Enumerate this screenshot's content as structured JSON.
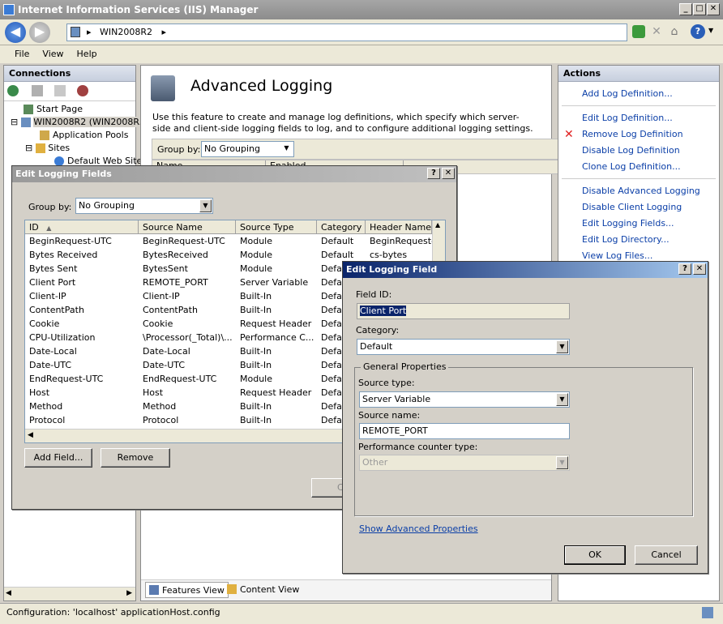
{
  "window": {
    "title": "Internet Information Services (IIS) Manager"
  },
  "address": {
    "path": "WIN2008R2"
  },
  "menu": [
    "File",
    "View",
    "Help"
  ],
  "connections": {
    "title": "Connections",
    "tree": [
      "Start Page",
      "WIN2008R2 (WIN2008R...",
      "Application Pools",
      "Sites",
      "Default Web Site"
    ]
  },
  "center": {
    "title": "Advanced Logging",
    "description": "Use this feature to create and manage log definitions, which specify which server-side and client-side logging fields to log, and to configure additional logging settings.",
    "group_by_label": "Group by:",
    "group_by_value": "No Grouping",
    "col_name": "Name",
    "col_enabled": "Enabled",
    "features_view": "Features View",
    "content_view": "Content View"
  },
  "actions": {
    "title": "Actions",
    "items": [
      "Add Log Definition...",
      "Edit Log Definition...",
      "Remove Log Definition",
      "Disable Log Definition",
      "Clone Log Definition...",
      "Disable Advanced Logging",
      "Disable Client Logging",
      "Edit Logging Fields...",
      "Edit Log Directory...",
      "View Log Files..."
    ]
  },
  "fields_dialog": {
    "title": "Edit Logging Fields",
    "group_by_label": "Group by:",
    "group_by_value": "No Grouping",
    "columns": [
      "ID",
      "Source Name",
      "Source Type",
      "Category",
      "Header Name"
    ],
    "rows": [
      [
        "BeginRequest-UTC",
        "BeginRequest-UTC",
        "Module",
        "Default",
        "BeginRequest-..."
      ],
      [
        "Bytes Received",
        "BytesReceived",
        "Module",
        "Default",
        "cs-bytes"
      ],
      [
        "Bytes Sent",
        "BytesSent",
        "Module",
        "Defa",
        ""
      ],
      [
        "Client Port",
        "REMOTE_PORT",
        "Server Variable",
        "Defa",
        ""
      ],
      [
        "Client-IP",
        "Client-IP",
        "Built-In",
        "Defa",
        ""
      ],
      [
        "ContentPath",
        "ContentPath",
        "Built-In",
        "Defa",
        ""
      ],
      [
        "Cookie",
        "Cookie",
        "Request Header",
        "Defa",
        ""
      ],
      [
        "CPU-Utilization",
        "\\Processor(_Total)\\...",
        "Performance C...",
        "Defa",
        ""
      ],
      [
        "Date-Local",
        "Date-Local",
        "Built-In",
        "Defa",
        ""
      ],
      [
        "Date-UTC",
        "Date-UTC",
        "Built-In",
        "Defa",
        ""
      ],
      [
        "EndRequest-UTC",
        "EndRequest-UTC",
        "Module",
        "Defa",
        ""
      ],
      [
        "Host",
        "Host",
        "Request Header",
        "Defa",
        ""
      ],
      [
        "Method",
        "Method",
        "Built-In",
        "Defa",
        ""
      ],
      [
        "Protocol",
        "Protocol",
        "Built-In",
        "Defa",
        ""
      ]
    ],
    "add_button": "Add Field...",
    "remove_button": "Remove",
    "hidden_button": "C"
  },
  "field_dialog": {
    "title": "Edit Logging Field",
    "field_id_label": "Field ID:",
    "field_id_value": "Client Port",
    "category_label": "Category:",
    "category_value": "Default",
    "general_group": "General Properties",
    "source_type_label": "Source type:",
    "source_type_value": "Server Variable",
    "source_name_label": "Source name:",
    "source_name_value": "REMOTE_PORT",
    "perf_label": "Performance counter type:",
    "perf_value": "Other",
    "advanced_link": "Show Advanced Properties",
    "ok": "OK",
    "cancel": "Cancel"
  },
  "status": {
    "text": "Configuration: 'localhost' applicationHost.config"
  }
}
